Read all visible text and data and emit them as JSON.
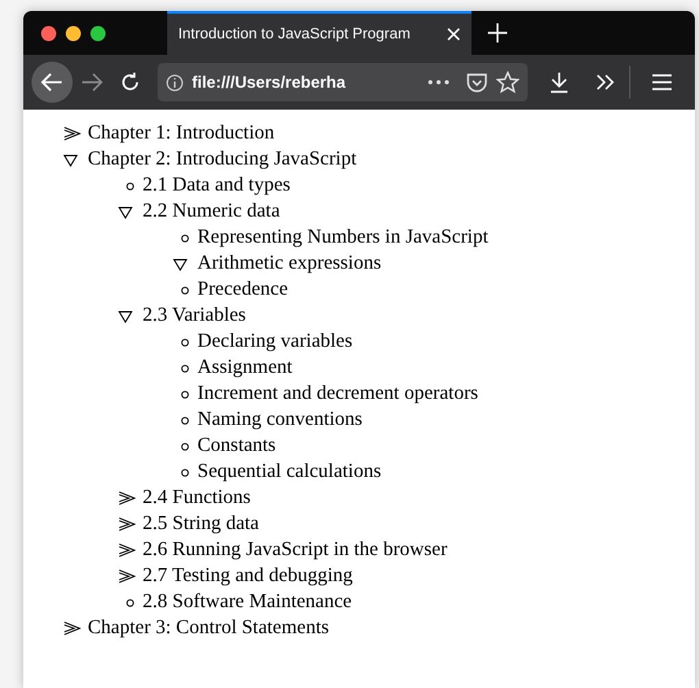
{
  "window": {
    "tab": {
      "title": "Introduction to JavaScript Program",
      "selected": true
    },
    "address": "file:///Users/reberha"
  },
  "outline": [
    {
      "label": "Chapter 1: Introduction",
      "kind": "branch",
      "expanded": false
    },
    {
      "label": "Chapter 2: Introducing JavaScript",
      "kind": "branch",
      "expanded": true,
      "children": [
        {
          "label": "2.1 Data and types",
          "kind": "leaf"
        },
        {
          "label": "2.2 Numeric data",
          "kind": "branch",
          "expanded": true,
          "children": [
            {
              "label": "Representing Numbers in JavaScript",
              "kind": "leaf"
            },
            {
              "label": "Arithmetic expressions",
              "kind": "branch",
              "expanded": true
            },
            {
              "label": "Precedence",
              "kind": "leaf"
            }
          ]
        },
        {
          "label": "2.3 Variables",
          "kind": "branch",
          "expanded": true,
          "children": [
            {
              "label": "Declaring variables",
              "kind": "leaf"
            },
            {
              "label": "Assignment",
              "kind": "leaf"
            },
            {
              "label": "Increment and decrement operators",
              "kind": "leaf"
            },
            {
              "label": "Naming conventions",
              "kind": "leaf"
            },
            {
              "label": "Constants",
              "kind": "leaf"
            },
            {
              "label": "Sequential calculations",
              "kind": "leaf"
            }
          ]
        },
        {
          "label": "2.4 Functions",
          "kind": "branch",
          "expanded": false
        },
        {
          "label": "2.5 String data",
          "kind": "branch",
          "expanded": false
        },
        {
          "label": "2.6 Running JavaScript in the browser",
          "kind": "branch",
          "expanded": false
        },
        {
          "label": "2.7 Testing and debugging",
          "kind": "branch",
          "expanded": false
        },
        {
          "label": "2.8 Software Maintenance",
          "kind": "leaf"
        }
      ]
    },
    {
      "label": "Chapter 3: Control Statements",
      "kind": "branch",
      "expanded": false
    }
  ]
}
